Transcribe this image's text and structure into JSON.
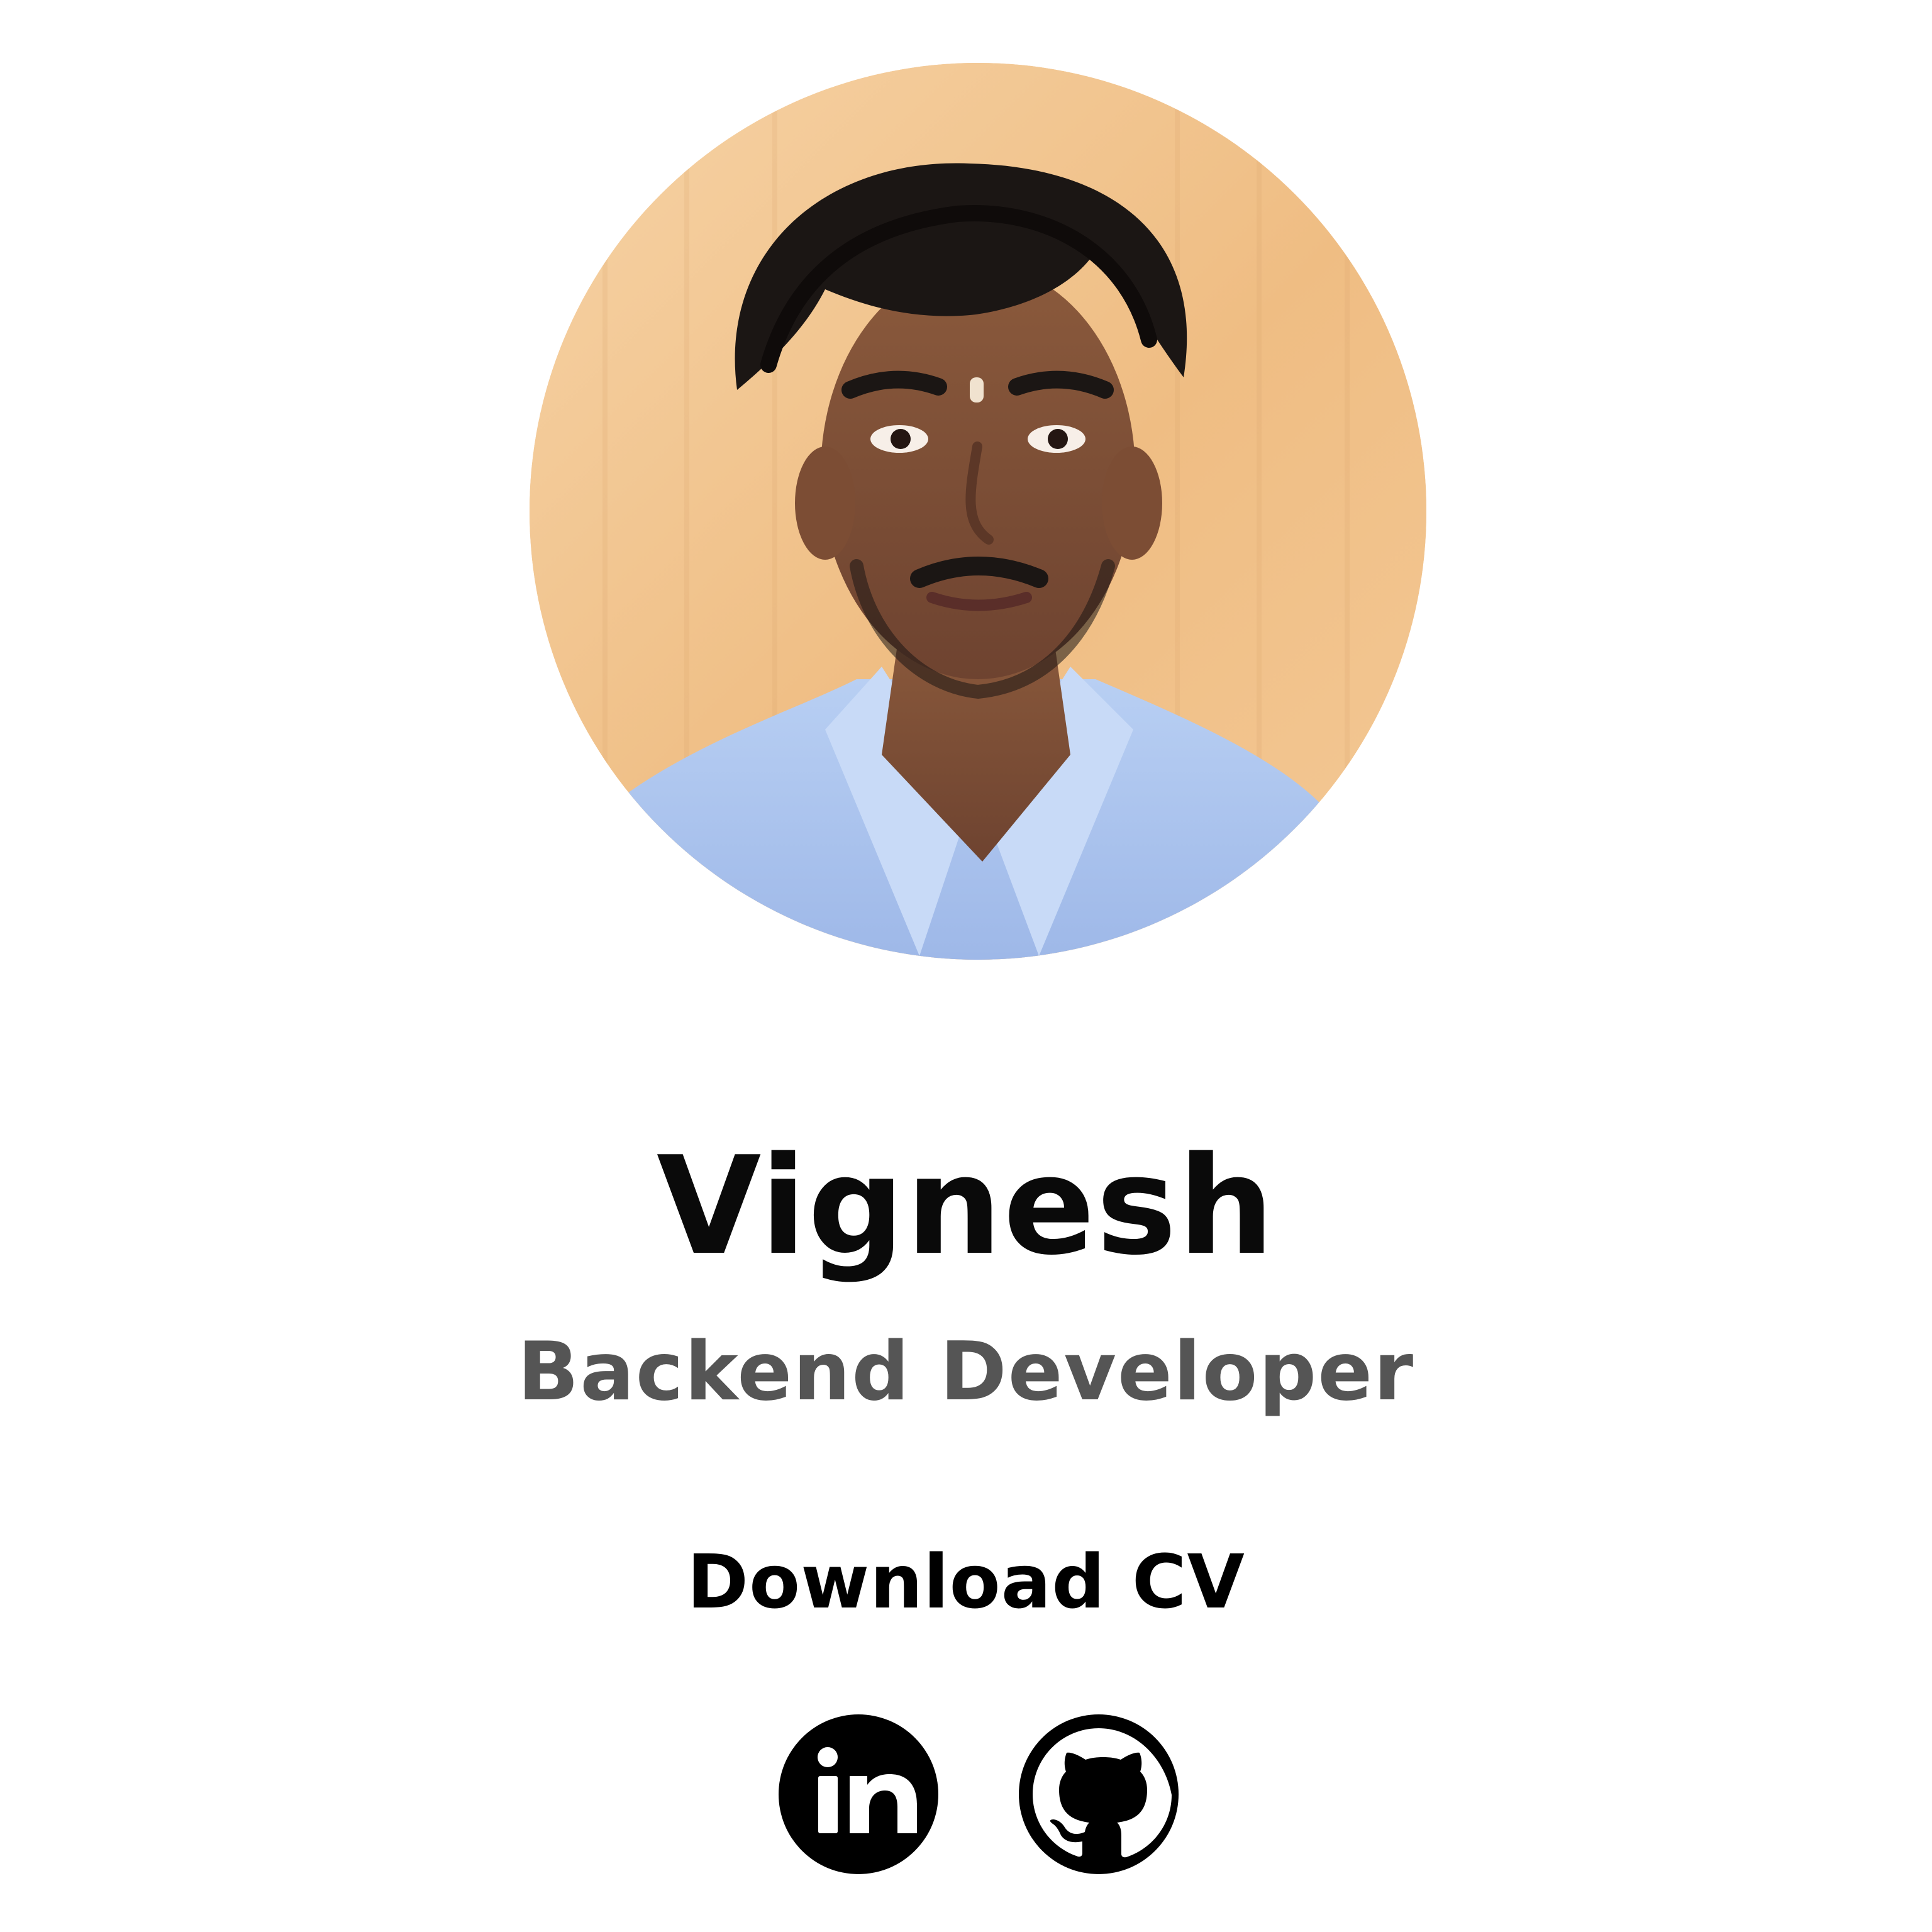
{
  "profile": {
    "name": "Vignesh",
    "role": "Backend Developer"
  },
  "actions": {
    "download_cv_label": "Download CV"
  },
  "social": {
    "items": [
      {
        "platform": "LinkedIn",
        "icon": "linkedin-icon"
      },
      {
        "platform": "GitHub",
        "icon": "github-icon"
      }
    ]
  },
  "colors": {
    "background": "#ffffff",
    "name_text": "#0a0a0a",
    "role_text": "#555555",
    "link_text": "#000000",
    "social_icon": "#000000",
    "photo_background": "#f2c48f"
  }
}
